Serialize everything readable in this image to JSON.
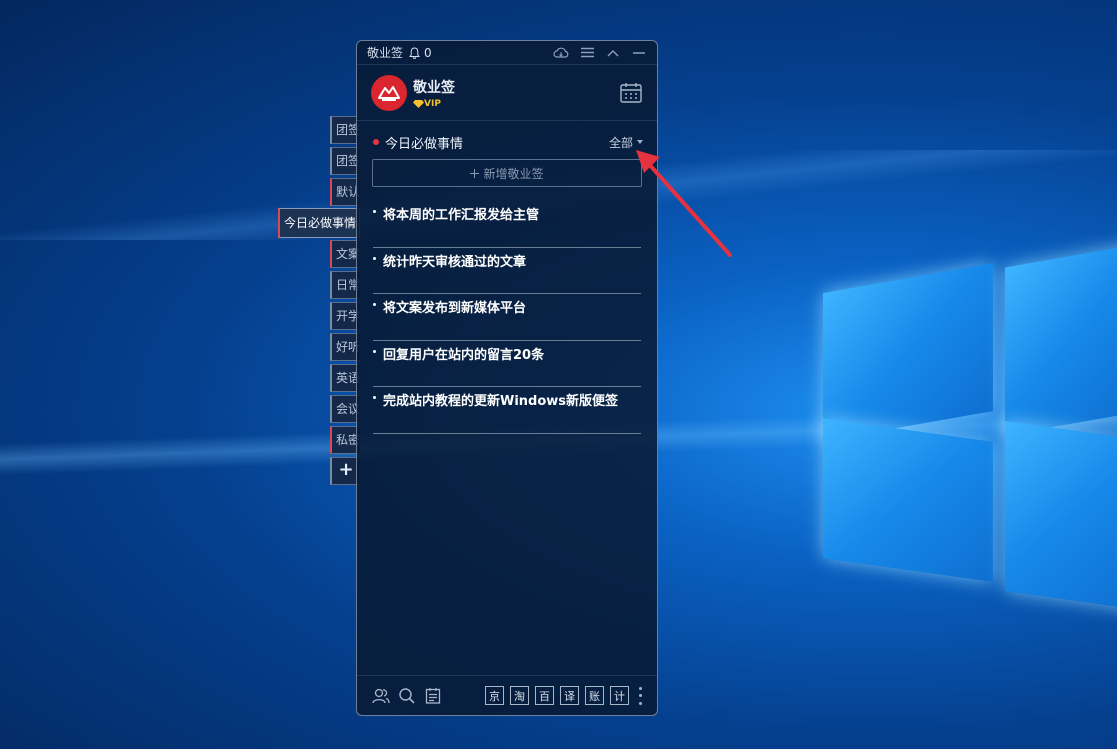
{
  "colors": {
    "accent_red": "#e8343e",
    "window_bg": "#081a34",
    "vip_gold": "#f3c12a",
    "annotation_arrow": "#e5323f"
  },
  "side_tabs": [
    {
      "label": "团签",
      "color": "#7a8ba5"
    },
    {
      "label": "团签",
      "color": "#7a8ba5"
    },
    {
      "label": "默认",
      "color": "#d84a5a"
    },
    {
      "label": "今日必做事情",
      "color": "#d84a5a",
      "active": true
    },
    {
      "label": "文案",
      "color": "#d84a5a"
    },
    {
      "label": "日常",
      "color": "#7a8ba5"
    },
    {
      "label": "开学",
      "color": "#7a8ba5"
    },
    {
      "label": "好听",
      "color": "#7a8ba5"
    },
    {
      "label": "英语",
      "color": "#7a8ba5"
    },
    {
      "label": "会议",
      "color": "#7a8ba5"
    },
    {
      "label": "私密",
      "color": "#d84a5a"
    },
    {
      "label": "+",
      "icon": "plus-icon"
    }
  ],
  "titlebar": {
    "title": "敬业签",
    "notification_count": "0",
    "icons": [
      "bell-icon",
      "cloud-sync-icon",
      "menu-icon",
      "collapse-icon",
      "minimize-icon"
    ]
  },
  "header": {
    "app_name": "敬业签",
    "vip_label": "VIP",
    "icons": [
      "avatar-logo-icon",
      "diamond-icon",
      "calendar-icon"
    ]
  },
  "section": {
    "title": "今日必做事情",
    "filter_label": "全部"
  },
  "add_button": {
    "label": "新增敬业签",
    "icon": "plus-icon"
  },
  "tasks": [
    {
      "text": "将本周的工作汇报发给主管"
    },
    {
      "text": "统计昨天审核通过的文章"
    },
    {
      "text": "将文案发布到新媒体平台"
    },
    {
      "text": "回复用户在站内的留言20条"
    },
    {
      "text": "完成站内教程的更新Windows新版便签"
    }
  ],
  "bottombar": {
    "left_icons": [
      "team-icon",
      "search-icon",
      "notes-icon"
    ],
    "quick_buttons": [
      "京",
      "淘",
      "百",
      "译",
      "账",
      "计"
    ],
    "more_icon": "more-vertical-icon"
  }
}
